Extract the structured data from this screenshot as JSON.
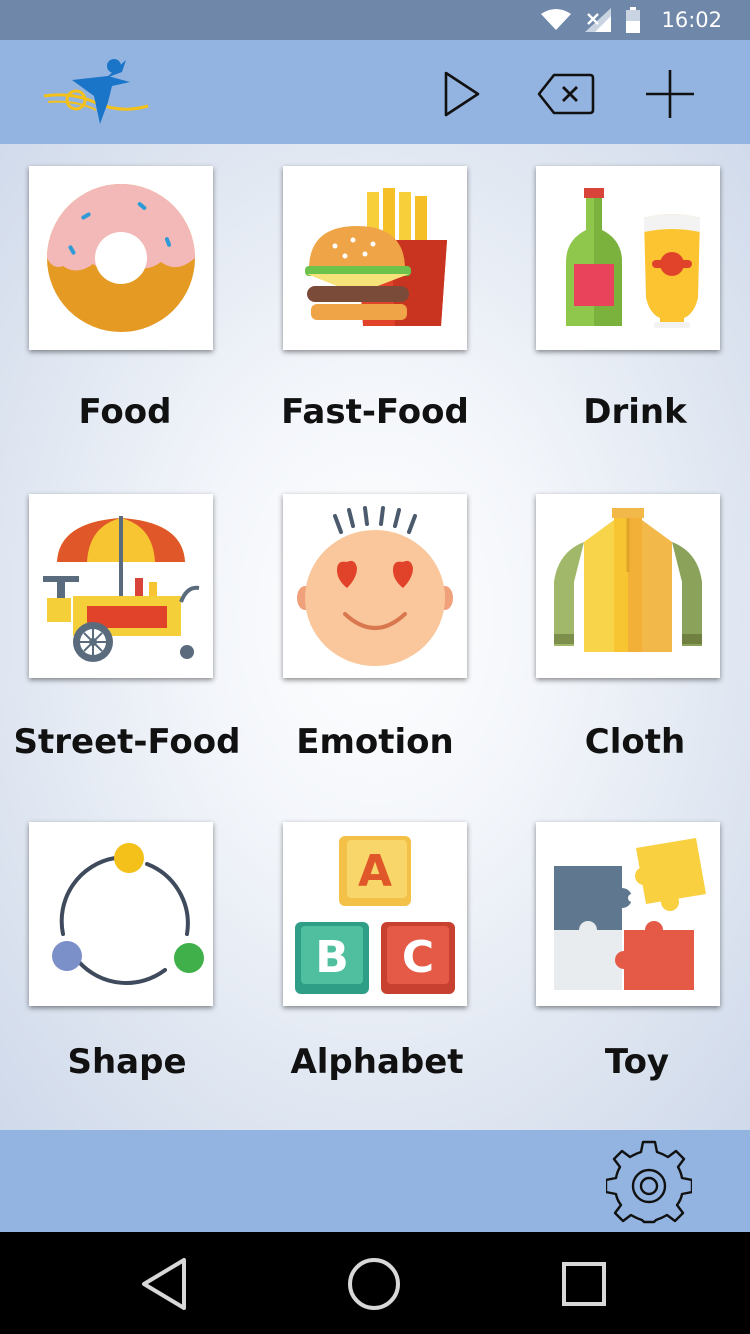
{
  "status_bar": {
    "time": "16:02"
  },
  "toolbar": {
    "logo_icon": "person-star-logo-icon",
    "play_icon": "play-icon",
    "backspace_icon": "backspace-icon",
    "add_icon": "plus-icon"
  },
  "categories": [
    {
      "label": "Food",
      "icon": "donut-icon"
    },
    {
      "label": "Fast-Food",
      "icon": "burger-fries-icon"
    },
    {
      "label": "Drink",
      "icon": "bottle-glass-icon"
    },
    {
      "label": "Street-Food",
      "icon": "food-cart-icon"
    },
    {
      "label": "Emotion",
      "icon": "love-face-icon"
    },
    {
      "label": "Cloth",
      "icon": "jacket-icon"
    },
    {
      "label": "Shape",
      "icon": "circle-dots-icon"
    },
    {
      "label": "Alphabet",
      "icon": "abc-blocks-icon"
    },
    {
      "label": "Toy",
      "icon": "puzzle-icon"
    }
  ],
  "bottom_bar": {
    "settings_icon": "gear-icon"
  },
  "nav_bar": {
    "back_icon": "back-triangle-icon",
    "home_icon": "home-circle-icon",
    "recent_icon": "recent-square-icon"
  },
  "colors": {
    "status_bar": "#6f87a8",
    "app_bar": "#93b4e0",
    "bottom_bar": "#93b4e0"
  }
}
